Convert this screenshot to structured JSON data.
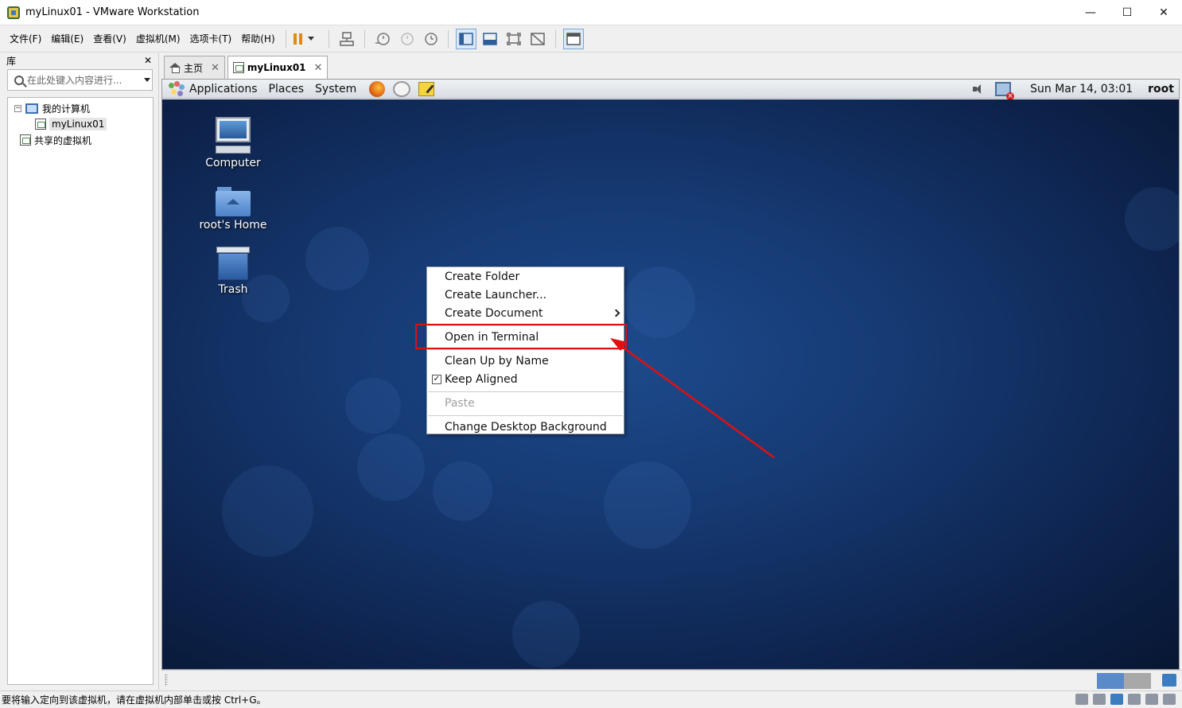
{
  "window": {
    "title": "myLinux01 - VMware Workstation",
    "minimize": "—",
    "maximize": "☐",
    "close": "✕"
  },
  "menu": [
    "文件(F)",
    "编辑(E)",
    "查看(V)",
    "虚拟机(M)",
    "选项卡(T)",
    "帮助(H)"
  ],
  "library": {
    "title": "库",
    "close": "✕",
    "search_placeholder": "在此处键入内容进行...",
    "tree": {
      "my_computer": "我的计算机",
      "toggle": "−",
      "vm": "myLinux01",
      "shared": "共享的虚拟机"
    }
  },
  "tabs": [
    {
      "label": "主页",
      "close": "✕"
    },
    {
      "label": "myLinux01",
      "close": "✕"
    }
  ],
  "guest_panel": {
    "menus": [
      "Applications",
      "Places",
      "System"
    ],
    "clock": "Sun Mar 14, 03:01",
    "user": "root"
  },
  "desktop_icons": [
    "Computer",
    "root's Home",
    "Trash"
  ],
  "context_menu": {
    "create_folder": "Create Folder",
    "create_launcher": "Create Launcher...",
    "create_document": "Create Document",
    "open_terminal": "Open in Terminal",
    "clean_up": "Clean Up by Name",
    "keep_aligned": "Keep Aligned",
    "keep_aligned_check": "✓",
    "paste": "Paste",
    "change_bg": "Change Desktop Background"
  },
  "status": {
    "text": "要将输入定向到该虚拟机，请在虚拟机内部单击或按 Ctrl+G。"
  },
  "colors": {
    "highlight": "#e01010",
    "desktop": "#163a73"
  }
}
